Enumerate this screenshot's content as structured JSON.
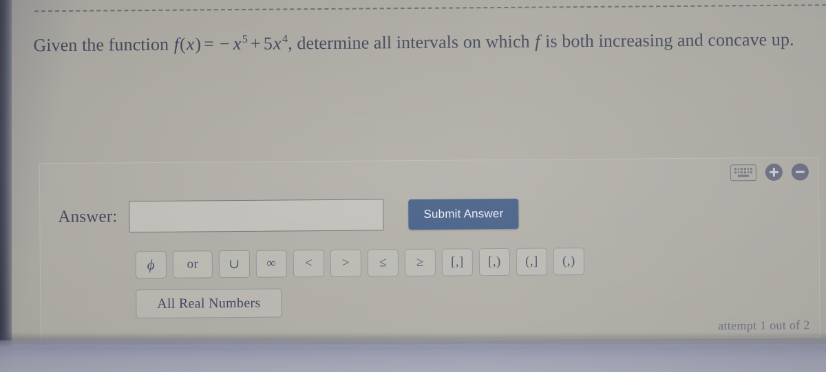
{
  "question": {
    "prefix": "Given the function ",
    "fn_name": "f",
    "fn_arg": "x",
    "equals": "=",
    "term1_sign": "−",
    "term1_var": "x",
    "term1_exp": "5",
    "plus": "+",
    "term2_coef": "5",
    "term2_var": "x",
    "term2_exp": "4",
    "middle": ", determine all intervals on which ",
    "italic_f": "f",
    "suffix": " is both increasing and concave up.",
    "full_text": "Given the function f(x) = −x⁵ + 5x⁴, determine all intervals on which f is both increasing and concave up.",
    "text_color": "#3e4257"
  },
  "panel": {
    "tools": {
      "keyboard_icon": "keyboard-icon",
      "zoom_in_icon": "plus-circle-icon",
      "zoom_out_icon": "minus-circle-icon"
    },
    "answer": {
      "label": "Answer:",
      "value": "",
      "placeholder": ""
    },
    "submit_label": "Submit Answer",
    "submit_color": "#3c5680",
    "symbol_buttons": [
      {
        "label": "ϕ",
        "name": "symbol-empty-set",
        "wide": false,
        "phi": true
      },
      {
        "label": "or",
        "name": "symbol-or",
        "wide": true,
        "phi": false
      },
      {
        "label": "∪",
        "name": "symbol-union",
        "wide": false,
        "phi": false
      },
      {
        "label": "∞",
        "name": "symbol-infinity",
        "wide": false,
        "phi": false
      },
      {
        "label": "<",
        "name": "symbol-less-than",
        "wide": false,
        "phi": false
      },
      {
        "label": ">",
        "name": "symbol-greater-than",
        "wide": false,
        "phi": false
      },
      {
        "label": "≤",
        "name": "symbol-less-equal",
        "wide": false,
        "phi": false
      },
      {
        "label": "≥",
        "name": "symbol-greater-equal",
        "wide": false,
        "phi": false
      },
      {
        "label": "[,]",
        "name": "symbol-closed-interval",
        "wide": false,
        "phi": false
      },
      {
        "label": "[,)",
        "name": "symbol-half-open-right-interval",
        "wide": false,
        "phi": false
      },
      {
        "label": "(,]",
        "name": "symbol-half-open-left-interval",
        "wide": false,
        "phi": false
      },
      {
        "label": "(,)",
        "name": "symbol-open-interval",
        "wide": false,
        "phi": false
      }
    ],
    "all_real_numbers_label": "All Real Numbers",
    "attempt_text": "attempt 1 out of 2"
  }
}
